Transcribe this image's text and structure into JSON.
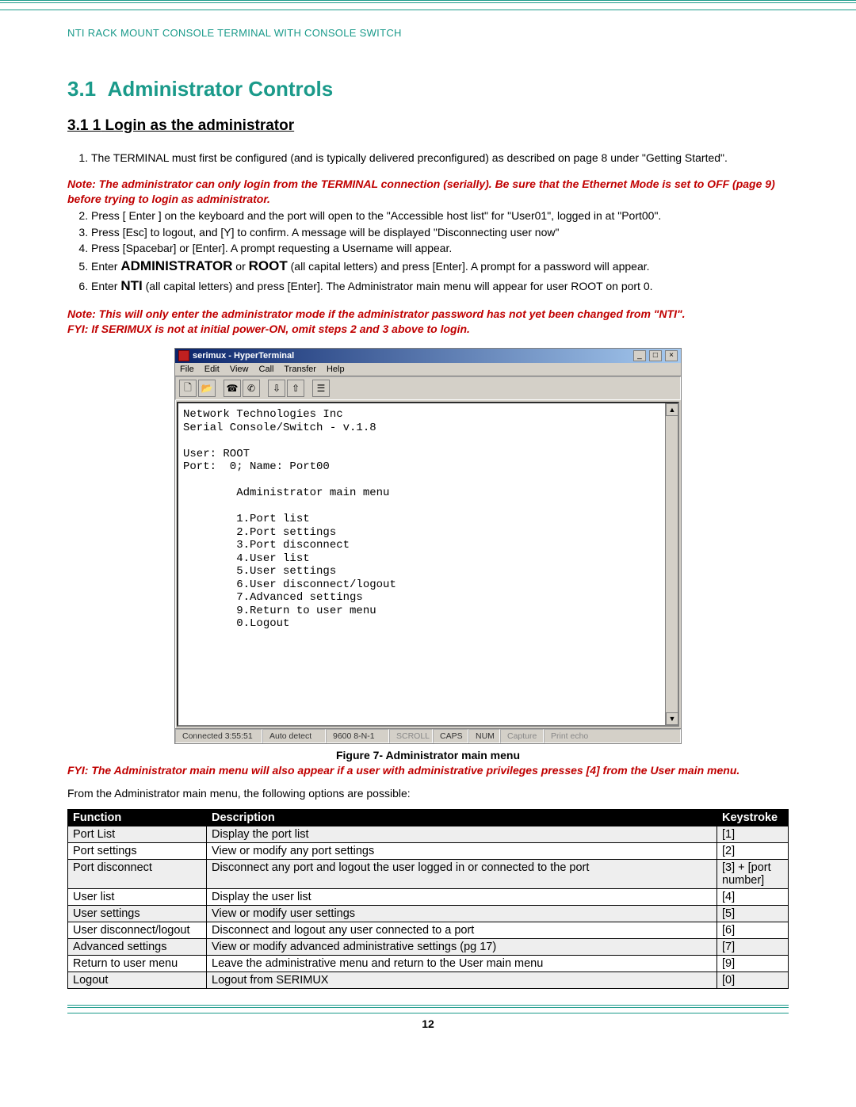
{
  "header": "NTI RACK MOUNT CONSOLE TERMINAL WITH CONSOLE SWITCH",
  "section_number": "3.1",
  "section_title": "Administrator Controls",
  "subsection_number": "3.1 1",
  "subsection_title": "Login as the administrator",
  "steps": {
    "s1": "The TERMINAL must first be configured (and is typically delivered preconfigured) as described on page 8 under \"Getting Started\".",
    "note1": "Note:   The administrator can only login from the TERMINAL connection (serially).   Be sure that the Ethernet Mode is set to OFF (page 9) before trying to login as administrator.",
    "s2": "Press [ Enter ] on the keyboard and the port will open to the \"Accessible host list\" for \"User01\", logged in at \"Port00\".",
    "s3": "Press [Esc] to logout,  and [Y] to confirm.     A message will be displayed \"Disconnecting user now\"",
    "s4": "Press [Spacebar] or [Enter].      A prompt requesting a Username will appear.",
    "s5a": "Enter ",
    "s5b": "ADMINISTRATOR",
    "s5c": " or ",
    "s5d": "ROOT",
    "s5e": " (all capital letters) and press [Enter].    A prompt for a password will appear.",
    "s6a": "Enter ",
    "s6b": "NTI",
    "s6c": " (all capital letters) and press [Enter].    The Administrator main menu will appear for user ROOT on port 0."
  },
  "notes": {
    "n1": "Note:  This will only enter the administrator mode if the administrator password has not yet been changed from \"NTI\".",
    "n2": "FYI:  If SERIMUX is not at initial power-ON, omit steps 2 and 3 above to login."
  },
  "hyperterm": {
    "title": "serimux - HyperTerminal",
    "menu": {
      "file": "File",
      "edit": "Edit",
      "view": "View",
      "call": "Call",
      "transfer": "Transfer",
      "help": "Help"
    },
    "content": "Network Technologies Inc\nSerial Console/Switch - v.1.8\n\nUser: ROOT\nPort:  0; Name: Port00\n\n        Administrator main menu\n\n        1.Port list\n        2.Port settings\n        3.Port disconnect\n        4.User list\n        5.User settings\n        6.User disconnect/logout\n        7.Advanced settings\n        9.Return to user menu\n        0.Logout",
    "status": {
      "time": "Connected 3:55:51",
      "detect": "Auto detect",
      "baud": "9600 8-N-1",
      "scroll": "SCROLL",
      "caps": "CAPS",
      "num": "NUM",
      "capture": "Capture",
      "echo": "Print echo"
    }
  },
  "figure_caption": "Figure 7-  Administrator main menu",
  "fyi_after_fig": "FYI: The Administrator main menu will also appear if a user with administrative privileges presses [4] from the User main menu.",
  "table_intro": "From the Administrator main menu, the following options are possible:",
  "table": {
    "h1": "Function",
    "h2": "Description",
    "h3": "Keystroke",
    "rows": [
      {
        "f": "Port List",
        "d": "Display the port list",
        "k": "[1]"
      },
      {
        "f": "Port settings",
        "d": "View or modify any port settings",
        "k": "[2]"
      },
      {
        "f": "Port disconnect",
        "d": "Disconnect any port and logout the user logged in or connected to the port",
        "k": "[3] + [port number]"
      },
      {
        "f": "User list",
        "d": "Display the user list",
        "k": "[4]"
      },
      {
        "f": "User settings",
        "d": "View or modify user settings",
        "k": "[5]"
      },
      {
        "f": "User disconnect/logout",
        "d": "Disconnect and logout any user connected to a port",
        "k": "[6]"
      },
      {
        "f": "Advanced settings",
        "d": "View or modify advanced administrative settings (pg 17)",
        "k": "[7]"
      },
      {
        "f": "Return to user menu",
        "d": "Leave the administrative menu and return to the User main menu",
        "k": "[9]"
      },
      {
        "f": "Logout",
        "d": "Logout from SERIMUX",
        "k": "[0]"
      }
    ]
  },
  "page_number": "12"
}
